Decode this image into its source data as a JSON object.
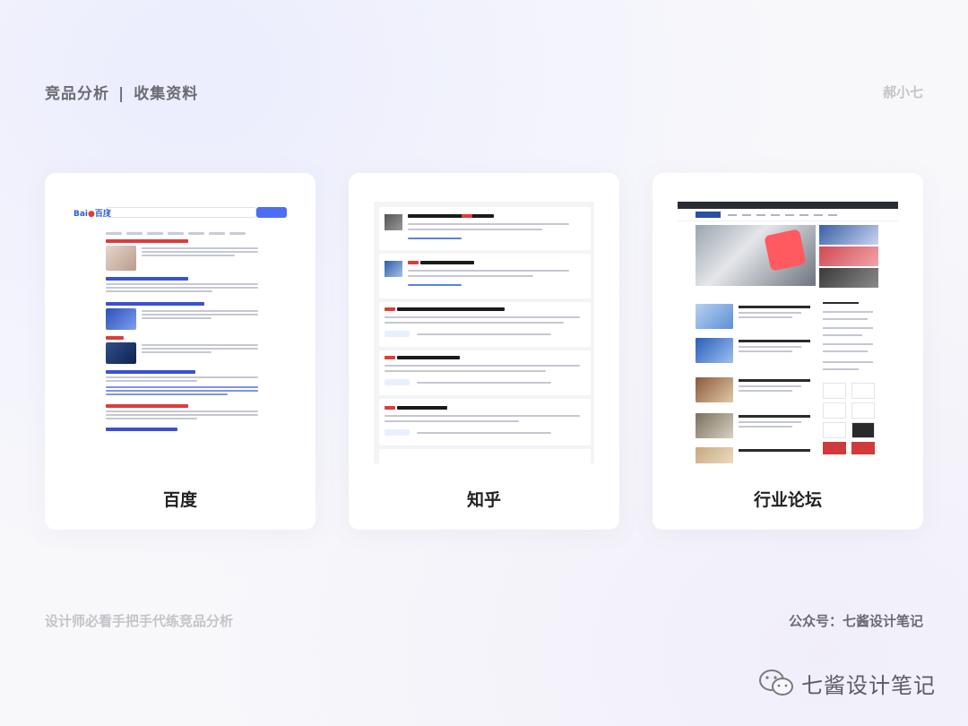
{
  "header": {
    "left_title": "竞品分析",
    "left_separator": "|",
    "left_subtitle": "收集资料",
    "right_author": "郝小七"
  },
  "cards": [
    {
      "caption": "百度"
    },
    {
      "caption": "知乎"
    },
    {
      "caption": "行业论坛"
    }
  ],
  "footer": {
    "left_text": "设计师必看手把手代练竞品分析",
    "right_text": "公众号：七酱设计笔记"
  },
  "watermark": {
    "text": "七酱设计笔记",
    "icon": "wechat-icon"
  },
  "colors": {
    "baidu_blue": "#4e6ef2",
    "baidu_red": "#e03b3b",
    "accent_zhihu": "#5a82e6"
  }
}
